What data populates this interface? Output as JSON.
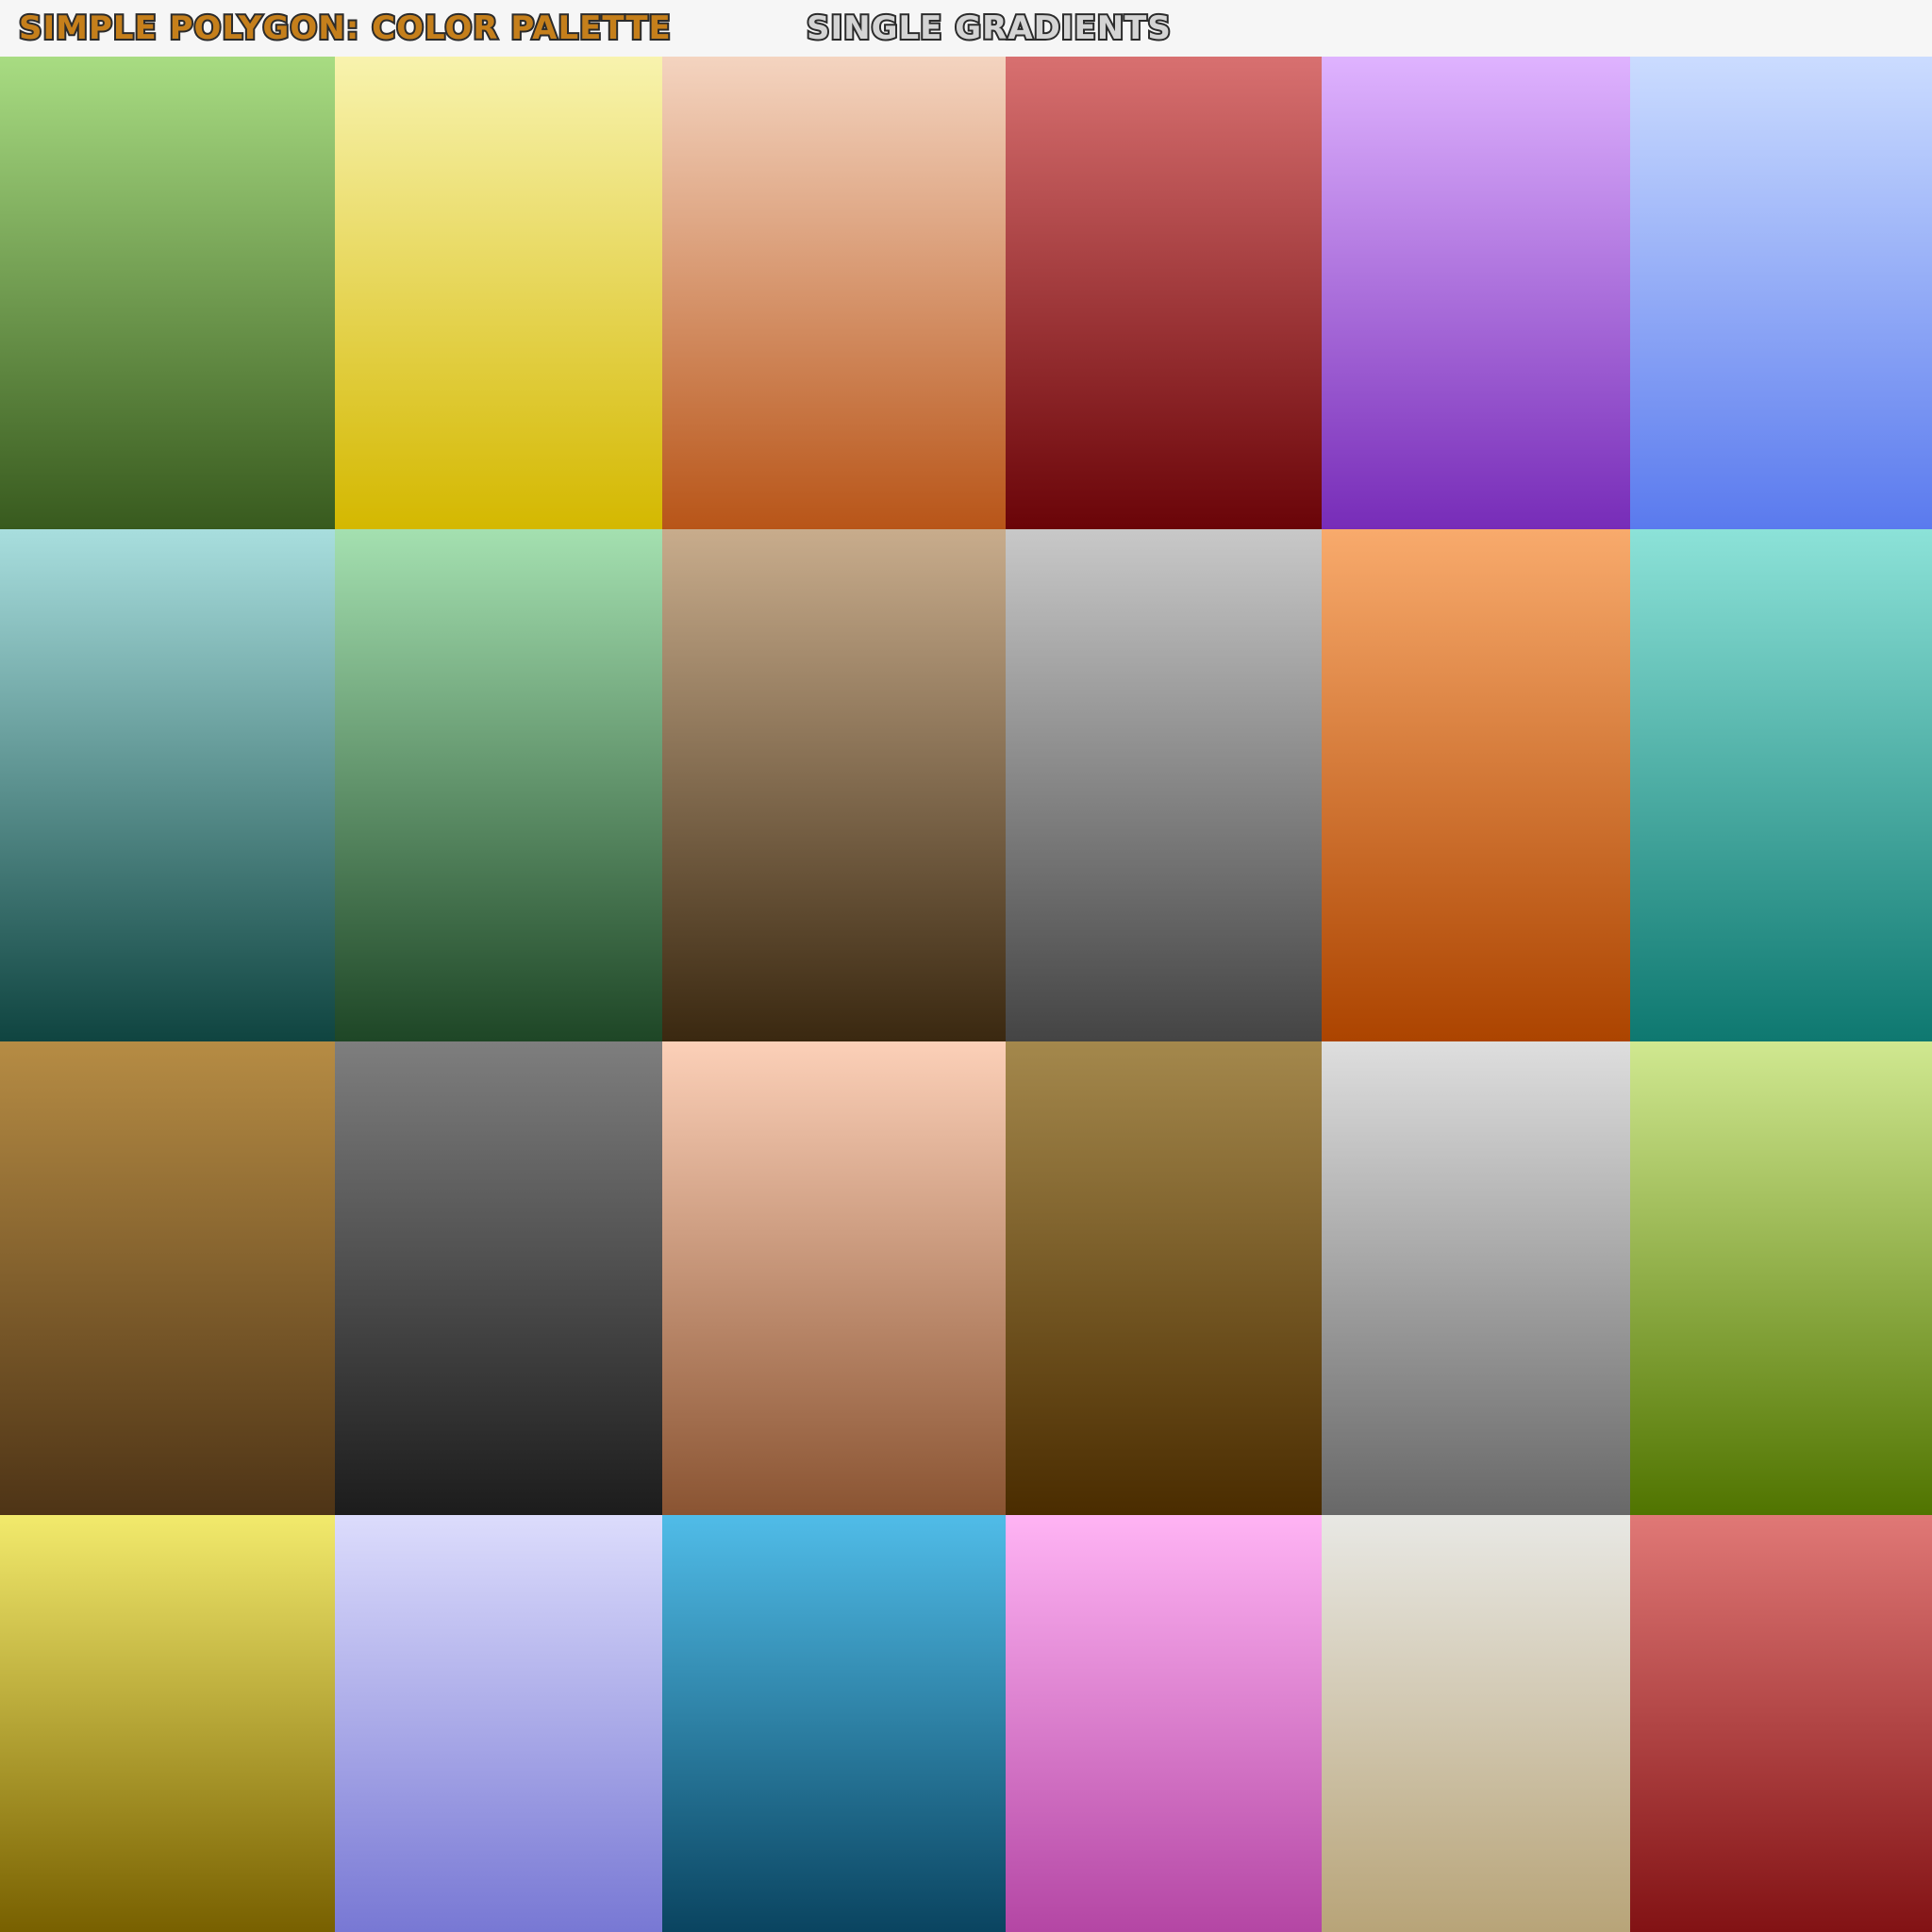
{
  "header": {
    "app_title": "SIMPLE POLYGON: COLOR PALETTE",
    "section_title": "SINGLE GRADIENTS"
  },
  "colors": {
    "header_bg": "#f6f6f6",
    "app_title_fill": "#c57f1b",
    "section_title_fill": "#d4d4d4",
    "title_outline": "#2b2b2b"
  },
  "swatches": [
    {
      "name": "green",
      "top": "#a8dc82",
      "bottom": "#385a1e"
    },
    {
      "name": "yellow",
      "top": "#f8f3ae",
      "bottom": "#d4b800"
    },
    {
      "name": "peach-orange",
      "top": "#f4d4c0",
      "bottom": "#b85518"
    },
    {
      "name": "red",
      "top": "#d87070",
      "bottom": "#6a0408"
    },
    {
      "name": "purple",
      "top": "#dfb3ff",
      "bottom": "#772cb8"
    },
    {
      "name": "blue",
      "top": "#cbdcff",
      "bottom": "#5a7aee"
    },
    {
      "name": "teal-gray",
      "top": "#a8dede",
      "bottom": "#0f4440"
    },
    {
      "name": "sage-green",
      "top": "#a4e0b0",
      "bottom": "#1e4626"
    },
    {
      "name": "brown",
      "top": "#c8ac8c",
      "bottom": "#3a2810"
    },
    {
      "name": "gray",
      "top": "#c8c8c8",
      "bottom": "#444444"
    },
    {
      "name": "orange",
      "top": "#f8aa6c",
      "bottom": "#ac4400"
    },
    {
      "name": "teal",
      "top": "#8ce2d8",
      "bottom": "#0e7870"
    },
    {
      "name": "ochre",
      "top": "#b68c44",
      "bottom": "#4e3416"
    },
    {
      "name": "dark-gray",
      "top": "#7e7e7e",
      "bottom": "#1c1c1c"
    },
    {
      "name": "skin",
      "top": "#fcd0b8",
      "bottom": "#8a5432"
    },
    {
      "name": "olive-brown",
      "top": "#a4884c",
      "bottom": "#4a2c00"
    },
    {
      "name": "light-gray",
      "top": "#dedede",
      "bottom": "#686868"
    },
    {
      "name": "lime-green",
      "top": "#d0e890",
      "bottom": "#507400"
    },
    {
      "name": "mustard",
      "top": "#f2ea6c",
      "bottom": "#786000"
    },
    {
      "name": "lavender",
      "top": "#dcdcfc",
      "bottom": "#7878d4"
    },
    {
      "name": "sky-blue",
      "top": "#50bce8",
      "bottom": "#0a4460"
    },
    {
      "name": "pink",
      "top": "#ffb4f4",
      "bottom": "#b446a4"
    },
    {
      "name": "beige",
      "top": "#e8e8e4",
      "bottom": "#b8a478"
    },
    {
      "name": "coral-red",
      "top": "#e07876",
      "bottom": "#821214"
    }
  ]
}
